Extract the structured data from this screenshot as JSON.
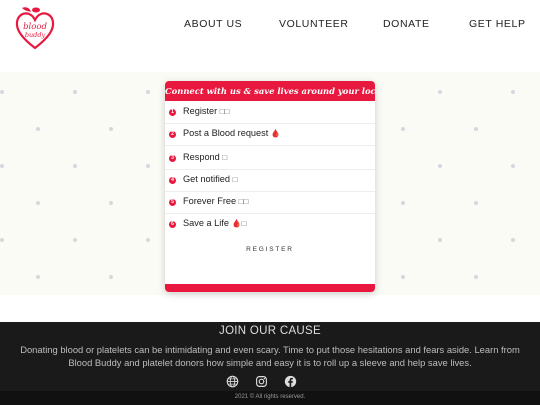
{
  "header": {
    "logo": {
      "line1": "blood",
      "line2": "buddy"
    },
    "nav": [
      {
        "label": "ABOUT US"
      },
      {
        "label": "VOLUNTEER"
      },
      {
        "label": "DONATE"
      },
      {
        "label": "GET HELP"
      }
    ]
  },
  "card": {
    "title": "Connect with us & save lives around your location",
    "steps": [
      {
        "num": "1",
        "label": "Register",
        "glyph": "□□"
      },
      {
        "num": "2",
        "label": "Post a Blood request",
        "glyph": "🩸"
      },
      {
        "num": "3",
        "label": "Respond",
        "glyph": "□"
      },
      {
        "num": "4",
        "label": "Get notified",
        "glyph": "□"
      },
      {
        "num": "5",
        "label": "Forever Free",
        "glyph": "□□"
      },
      {
        "num": "6",
        "label": "Save a Life",
        "glyph": "🩸□"
      }
    ],
    "register_link": "REGISTER"
  },
  "footer": {
    "title": "JOIN OUR CAUSE",
    "text": "Donating blood or platelets can be intimidating and even scary. Time to put those hesitations and fears aside. Learn from Blood Buddy and platelet donors how simple and easy it is to roll up a sleeve and help save lives.",
    "social_icons": [
      "globe-icon",
      "instagram-icon",
      "facebook-icon"
    ],
    "copyright": "2021 © All rights reserved."
  },
  "colors": {
    "brand_red": "#e8183f",
    "footer_bg": "#1a1a1a",
    "hero_bg": "#fbfbf6"
  }
}
